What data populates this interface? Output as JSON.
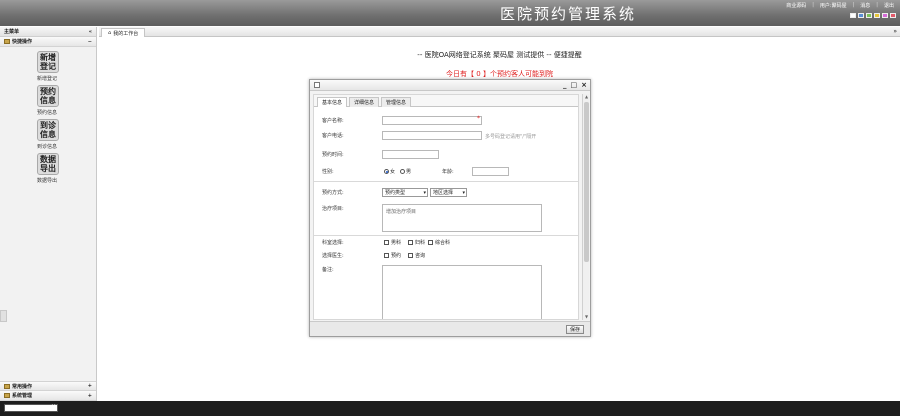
{
  "header": {
    "title": "医院预约管理系统",
    "links": [
      "商业源码",
      "用户:聚码屋",
      "消息",
      "退出"
    ],
    "theme_colors": [
      "#ffffff",
      "#5b8fd6",
      "#7cc25a",
      "#e5c33a",
      "#d46ad6",
      "#e25a6a"
    ]
  },
  "sidebar": {
    "title": "主菜单",
    "panel_quick": "快捷操作",
    "shortcuts": [
      {
        "btn": "新增登记",
        "label": "新增登记"
      },
      {
        "btn": "预约信息",
        "label": "预约信息"
      },
      {
        "btn": "到诊信息",
        "label": "到诊信息"
      },
      {
        "btn": "数据导出",
        "label": "数据导出"
      }
    ],
    "panel_common": "常用操作",
    "panel_system": "系统管理"
  },
  "tabs": {
    "workbench": "我的工作台"
  },
  "notice": "-- 医院OA网络登记系统 聚码屋 测试提供 -- 便捷提醒",
  "count_line": "今日有【 0 】个预约客人可能到院",
  "dialog": {
    "tabs": [
      "基本信息",
      "详细信息",
      "管理信息"
    ],
    "fields": {
      "name_label": "客户名称:",
      "phone_label": "客户电话:",
      "phone_hint": "多号码登记请用\"/\"隔开",
      "time_label": "预约时间:",
      "gender_label": "性别:",
      "gender_female": "女",
      "gender_male": "男",
      "age_label": "年龄:",
      "method_label": "预约方式:",
      "method_select": "预约类型",
      "region_select": "地区选择",
      "treatment_label": "治疗项目:",
      "treatment_placeholder": "增加治疗项目",
      "dept_label": "科室选择:",
      "dept_options": [
        "男科",
        "妇科",
        "综合科"
      ],
      "doctor_label": "选择医生:",
      "doctor_options": [
        "预约",
        "咨询"
      ],
      "remark_label": "备注:"
    },
    "save_label": "保存"
  }
}
